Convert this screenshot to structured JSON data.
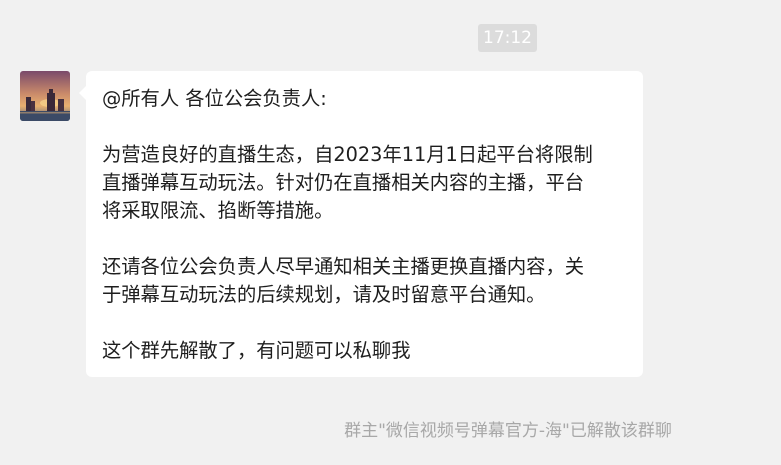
{
  "chat": {
    "timestamp": "17:12",
    "message": {
      "avatar_icon": "sunset-cityscape-avatar",
      "line1": "@所有人 各位公会负责人:",
      "para1_line1": "为营造良好的直播生态，自2023年11月1日起平台将限制",
      "para1_line2": "直播弹幕互动玩法。针对仍在直播相关内容的主播，平台",
      "para1_line3": "将采取限流、掐断等措施。",
      "para2_line1": "还请各位公会负责人尽早通知相关主播更换直播内容，关",
      "para2_line2": "于弹幕互动玩法的后续规划，请及时留意平台通知。",
      "para3_line1": "这个群先解散了，有问题可以私聊我"
    },
    "system_notice": "群主\"微信视频号弹幕官方-海\"已解散该群聊"
  },
  "colors": {
    "background": "#f1f1f1",
    "bubble": "#ffffff",
    "timestamp_bg": "#dcdcdc",
    "notice_text": "#a8a8a8"
  }
}
